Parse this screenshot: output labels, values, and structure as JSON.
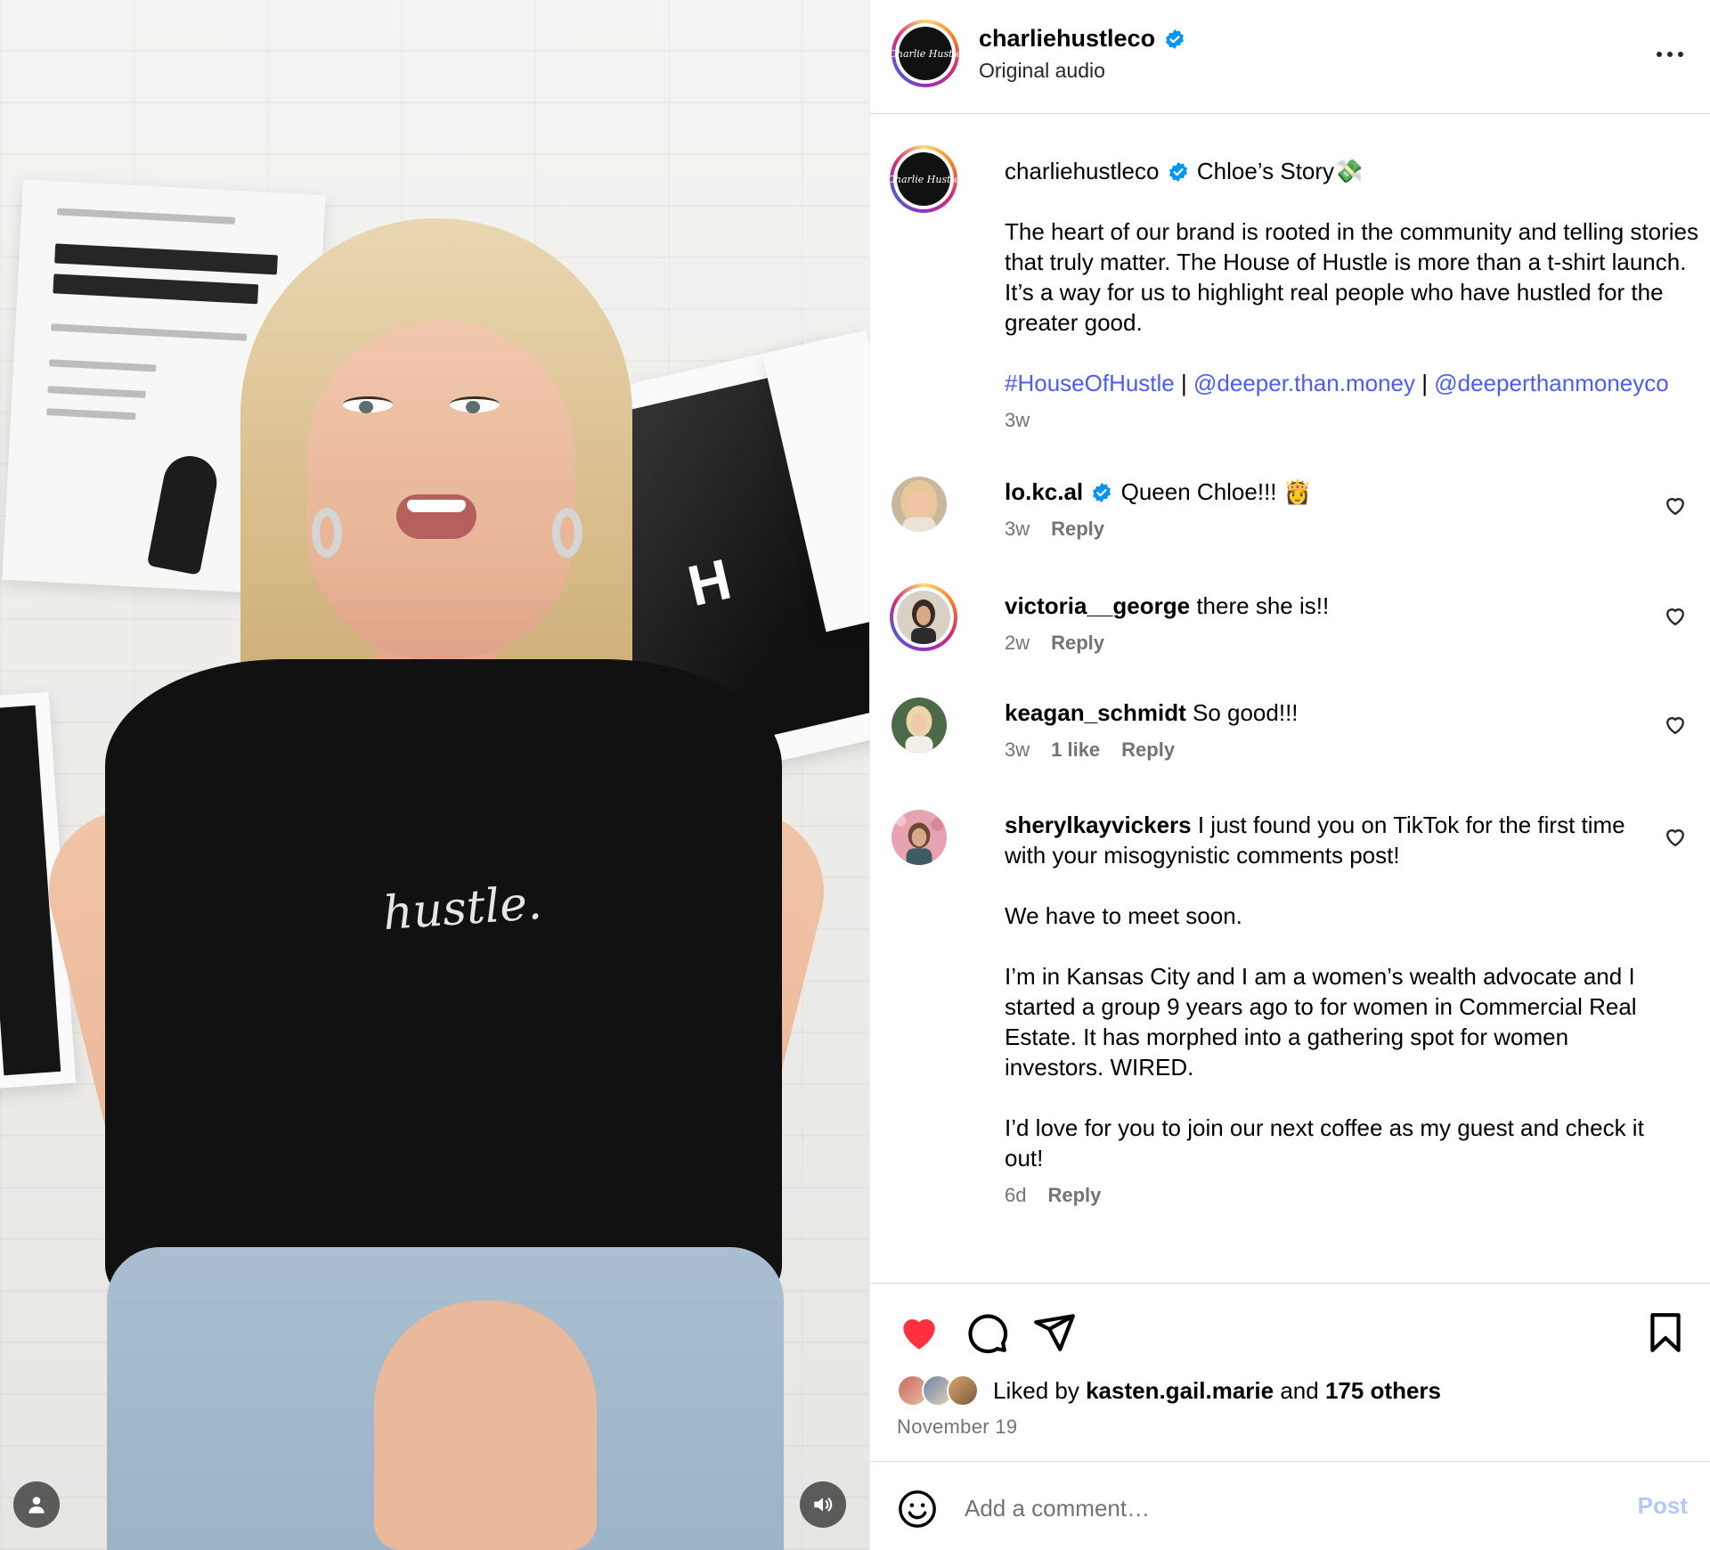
{
  "media": {
    "shirt_text": "hustle.",
    "poster_mark": "H",
    "buttons": {
      "user_tag_icon": "user-tag-icon",
      "sound_icon": "speaker-icon"
    }
  },
  "header": {
    "username": "charliehustleco",
    "verified": true,
    "subtitle": "Original audio",
    "avatar_text": "Charlie Hustle",
    "more_icon": "more-horizontal-icon"
  },
  "caption": {
    "username": "charliehustleco",
    "title": "Chloe’s Story💸",
    "text": "The heart of our brand is rooted in the community and telling stories that truly matter. The House of Hustle is more than a t-shirt launch. It’s a way for us to highlight real people who have hustled for the greater good.",
    "hashtag": "#HouseOfHustle",
    "separator": "|",
    "mention_1": "@deeper.than.money",
    "mention_2": "@deeperthanmoneyco",
    "time": "3w"
  },
  "comments": [
    {
      "username": "lo.kc.al",
      "verified": true,
      "text": "Queen Chloe!!! 👸",
      "time": "3w",
      "likes": "",
      "reply": "Reply"
    },
    {
      "username": "victoria__george",
      "verified": false,
      "text": "there she is!!",
      "time": "2w",
      "likes": "",
      "reply": "Reply"
    },
    {
      "username": "keagan_schmidt",
      "verified": false,
      "text": "So good!!!",
      "time": "3w",
      "likes": "1 like",
      "reply": "Reply"
    },
    {
      "username": "sherylkayvickers",
      "verified": false,
      "text": "I just found you on TikTok for the first time with your misogynistic comments post!",
      "text_2": "We have to meet soon.",
      "text_3": "I’m in Kansas City and I am a women’s wealth advocate and I started a group 9 years ago to for women in Commercial Real Estate. It has morphed into a gathering spot for women investors. WIRED.",
      "text_4": "I’d love for you to join our next coffee as my guest and check it out!",
      "time": "6d",
      "likes": "",
      "reply": "Reply"
    }
  ],
  "actions": {
    "like_icon": "heart-filled-icon",
    "comment_icon": "comment-icon",
    "share_icon": "share-icon",
    "save_icon": "bookmark-icon",
    "liked_prefix": "Liked by",
    "liked_user": "kasten.gail.marie",
    "liked_and": "and",
    "liked_others": "175 others",
    "date": "November 19"
  },
  "composer": {
    "emoji_icon": "emoji-icon",
    "placeholder": "Add a comment…",
    "post_label": "Post"
  },
  "colors": {
    "like_red": "#ff3040",
    "link_blue": "#4a5df9",
    "verified_blue": "#0095f6",
    "muted": "#737373",
    "post_disabled": "#b3c8fb"
  }
}
